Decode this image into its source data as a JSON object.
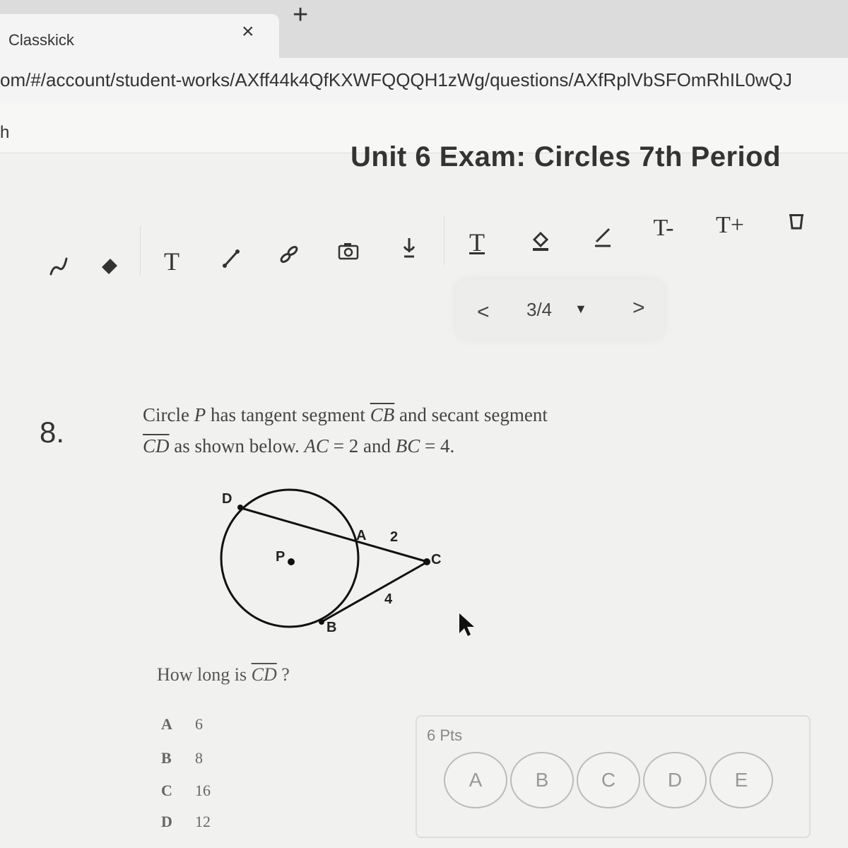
{
  "browser": {
    "tab_title": "Classkick",
    "close_glyph": "×",
    "new_tab_glyph": "+",
    "url": "om/#/account/student-works/AXff44k4QfKXWFQQQH1zWg/questions/AXfRplVbSFOmRhIL0wQJ",
    "bookmark_fragment": "h"
  },
  "header": {
    "title": "Unit 6 Exam: Circles 7th Period"
  },
  "toolbar": {
    "text_tool": "T",
    "text_style_tool": "T",
    "font_smaller": "T-",
    "font_larger": "T+",
    "icons": [
      "pen-icon",
      "eraser-icon",
      "text-icon",
      "line-icon",
      "link-icon",
      "camera-icon",
      "audio-icon",
      "text-style-icon",
      "fill-icon",
      "line-style-icon",
      "font-smaller-icon",
      "font-larger-icon",
      "trash-icon"
    ]
  },
  "pager": {
    "prev": "<",
    "label": "3/4",
    "caret": "▼",
    "next": ">"
  },
  "question": {
    "number": "8.",
    "line1_a": "Circle ",
    "P": "P",
    "line1_b": " has tangent segment ",
    "CB": "CB",
    "line1_c": " and secant segment",
    "CD": "CD",
    "line2_a": " as shown below. ",
    "AC": "AC",
    "line2_b": " = 2 and ",
    "BC": "BC",
    "line2_c": " = 4.",
    "prompt_a": "How long is ",
    "prompt_seg": "CD",
    "prompt_b": " ?",
    "diagram": {
      "label_D": "D",
      "label_A": "A",
      "label_P": "P",
      "label_C": "C",
      "label_B": "B",
      "label_AC": "2",
      "label_BC": "4"
    },
    "choices": [
      {
        "letter": "A",
        "value": "6"
      },
      {
        "letter": "B",
        "value": "8"
      },
      {
        "letter": "C",
        "value": "16"
      },
      {
        "letter": "D",
        "value": "12"
      }
    ]
  },
  "answer_panel": {
    "points": "6 Pts",
    "options": [
      "A",
      "B",
      "C",
      "D",
      "E"
    ]
  }
}
